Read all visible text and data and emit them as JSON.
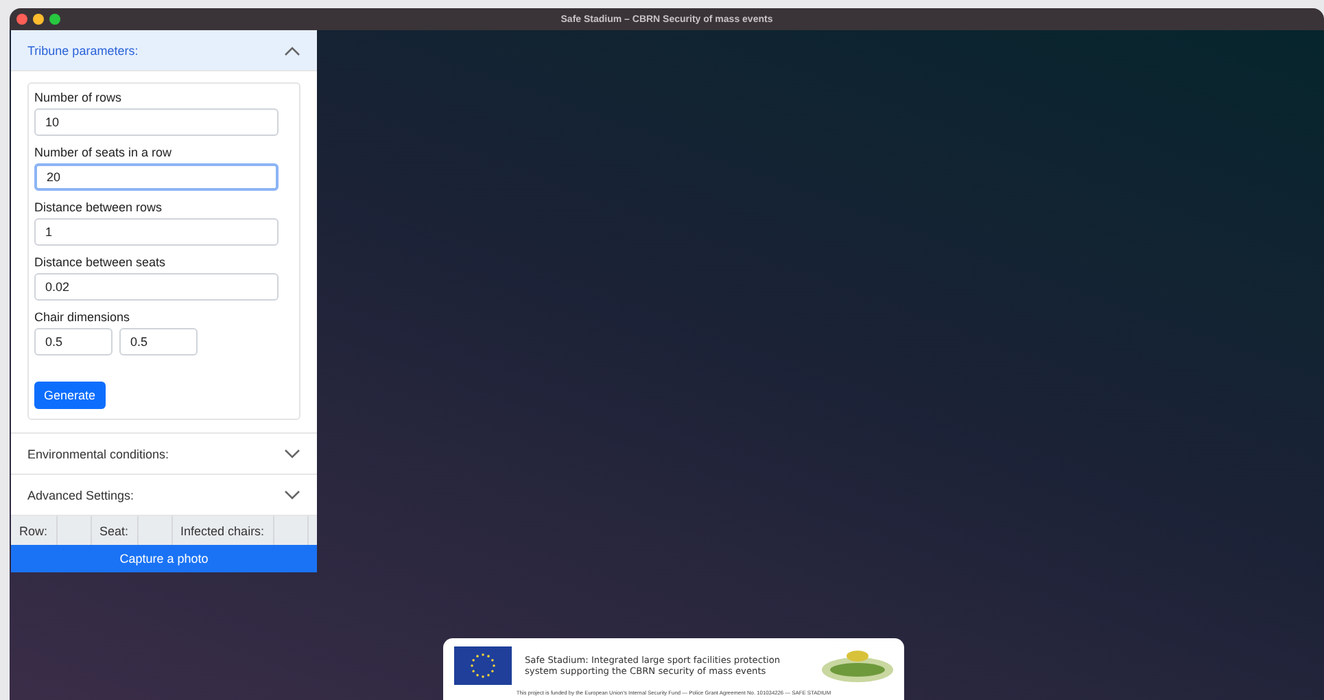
{
  "window": {
    "title": "Safe Stadium – CBRN Security of mass events"
  },
  "sections": [
    {
      "title": "Tribune parameters:",
      "expanded": true
    },
    {
      "title": "Environmental conditions:",
      "expanded": false
    },
    {
      "title": "Advanced Settings:",
      "expanded": false
    }
  ],
  "fields": [
    {
      "label": "Number of rows",
      "values": [
        "10"
      ],
      "focused": false
    },
    {
      "label": "Number of seats in a row",
      "values": [
        "20"
      ],
      "focused": true
    },
    {
      "label": "Distance between rows",
      "values": [
        "1"
      ],
      "focused": false
    },
    {
      "label": "Distance between seats",
      "values": [
        "0.02"
      ],
      "focused": false
    },
    {
      "label": "Chair dimensions",
      "values": [
        "0.5",
        "0.5"
      ],
      "focused": false
    }
  ],
  "generate_button": "Generate",
  "status_bar": [
    "Row:",
    "Seat:",
    "Infected chairs:"
  ],
  "capture_button": "Capture a photo",
  "banner": {
    "text": "Safe Stadium: Integrated large sport facilities protection system supporting the CBRN security of mass events",
    "funding": "This project is funded by the European Union's Internal Security Fund — Police Grant Agreement No. 101034226 — SAFE STADIUM"
  }
}
